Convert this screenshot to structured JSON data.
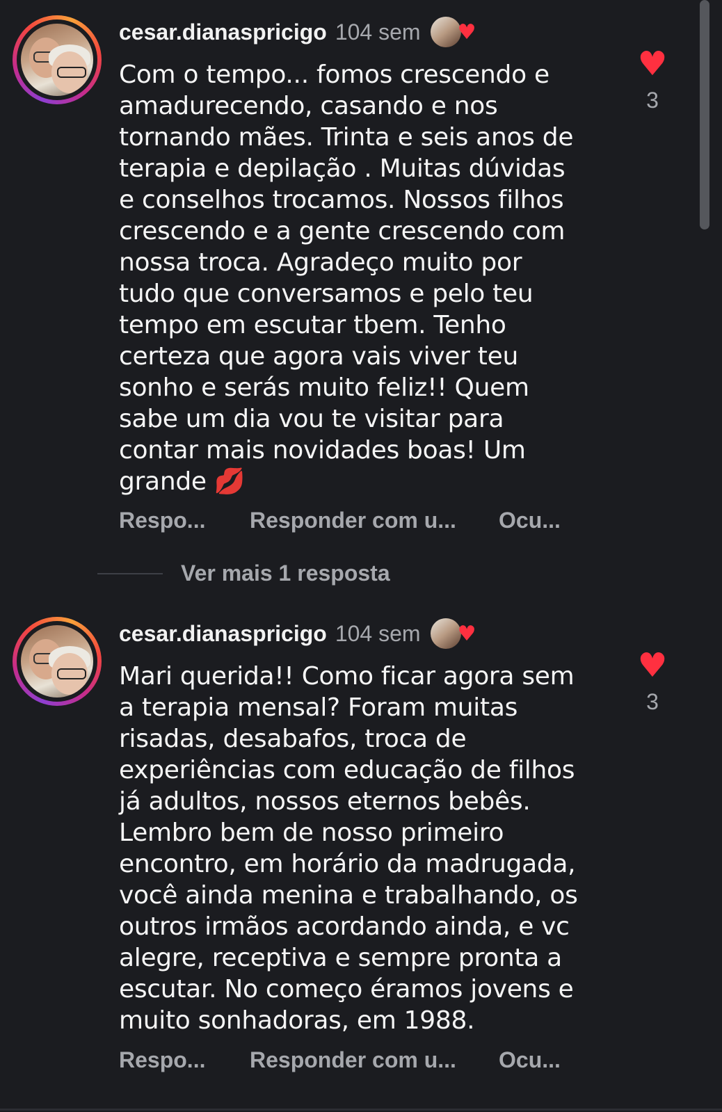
{
  "comments": [
    {
      "username": "cesar.dianaspricigo",
      "time": "104 sem",
      "likes": "3",
      "text": "Com o tempo... fomos crescendo e\namadurecendo, casando e nos\ntornando mães. Trinta e seis anos de\nterapia e depilação . Muitas dúvidas\ne conselhos trocamos. Nossos filhos\ncrescendo e a gente crescendo com\nnossa troca. Agradeço muito por\ntudo que conversamos e pelo teu\ntempo em escutar tbem. Tenho\ncerteza que agora vais viver teu\nsonho e serás muito feliz!! Quem\nsabe um dia vou te visitar para\ncontar mais novidades boas!  Um\ngrande ",
      "emoji": "💋",
      "actions": {
        "reply": "Respo...",
        "reply_with": "Responder com u...",
        "hide": "Ocu..."
      }
    },
    {
      "username": "cesar.dianaspricigo",
      "time": "104 sem",
      "likes": "3",
      "text": "Mari querida!! Como ficar agora sem\na terapia mensal? Foram muitas\nrisadas, desabafos, troca de\nexperiências com educação de filhos\njá adultos, nossos eternos bebês.\nLembro bem de nosso primeiro\nencontro, em horário da madrugada,\nvocê ainda menina e trabalhando, os\noutros irmãos acordando ainda, e vc\nalegre, receptiva e sempre pronta a\nescutar. No começo éramos jovens e\nmuito sonhadoras, em 1988.",
      "actions": {
        "reply": "Respo...",
        "reply_with": "Responder com u...",
        "hide": "Ocu..."
      }
    }
  ],
  "view_more": "Ver mais 1 resposta",
  "icons": {
    "like": "heart-icon",
    "creator_like": "creator-heart-icon"
  },
  "colors": {
    "background": "#1b1c20",
    "heart": "#ff3040",
    "muted": "#a6a8ad"
  }
}
